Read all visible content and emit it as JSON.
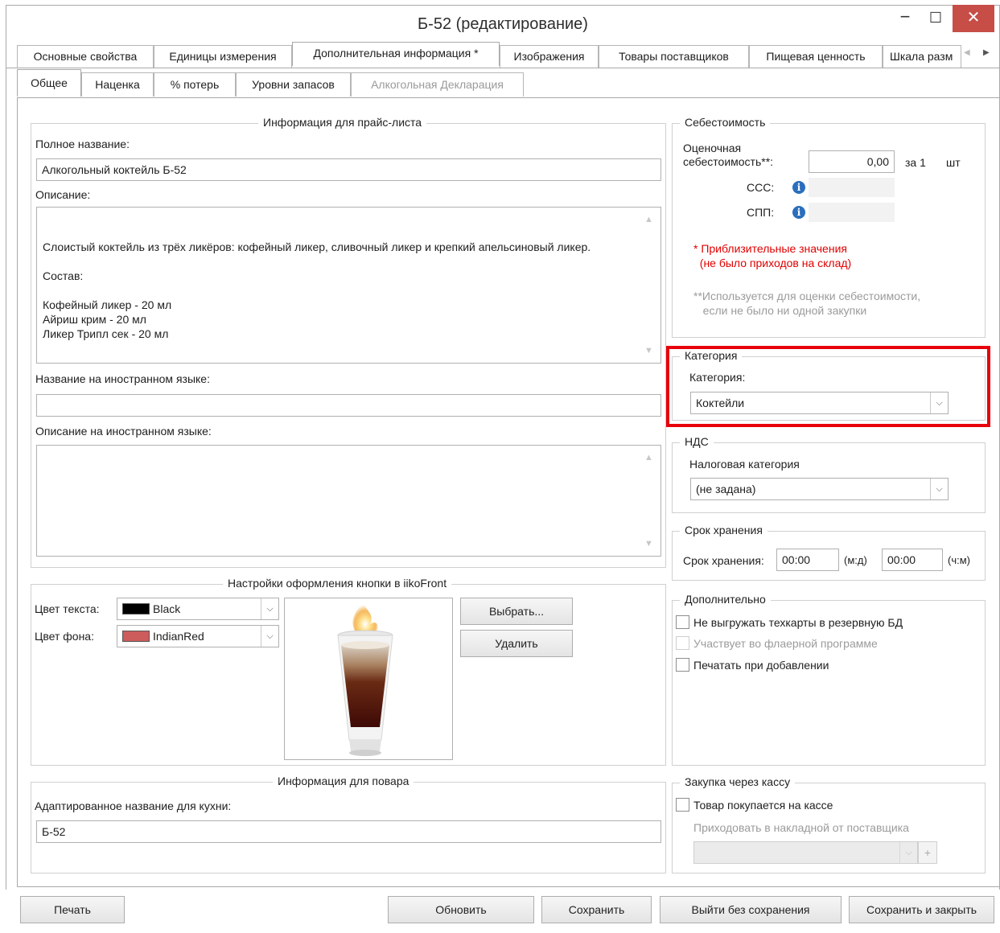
{
  "window": {
    "title": "Б-52 (редактирование)",
    "minimize": "−",
    "maximize": "☐",
    "close": "✕"
  },
  "tabs_main": [
    "Основные свойства",
    "Единицы измерения",
    "Дополнительная информация *",
    "Изображения",
    "Товары поставщиков",
    "Пищевая ценность",
    "Шкала разм"
  ],
  "tabs_sub": [
    "Общее",
    "Наценка",
    "% потерь",
    "Уровни запасов",
    "Алкогольная Декларация"
  ],
  "price_info": {
    "title": "Информация для прайс-листа",
    "full_name_label": "Полное название:",
    "full_name": "Алкогольный коктейль Б-52",
    "description_label": "Описание:",
    "description": "Слоистый коктейль из трёх ликёров: кофейный ликер, сливочный ликер и крепкий апельсиновый ликер.\n\nСостав:\n\nКофейный ликер - 20 мл\nАйриш крим - 20 мл\nЛикер Трипл сек - 20 мл",
    "foreign_name_label": "Название на иностранном языке:",
    "foreign_name": "",
    "foreign_desc_label": "Описание на иностранном языке:",
    "foreign_desc": ""
  },
  "button_settings": {
    "title": "Настройки оформления кнопки в iikoFront",
    "text_color_label": "Цвет текста:",
    "text_color_name": "Black",
    "text_color": "#000000",
    "bg_color_label": "Цвет фона:",
    "bg_color_name": "IndianRed",
    "bg_color": "#cd5c5c",
    "choose_button": "Выбрать...",
    "delete_button": "Удалить"
  },
  "cook_info": {
    "title": "Информация для повара",
    "kitchen_name_label": "Адаптированное название для кухни:",
    "kitchen_name": "Б-52"
  },
  "cost": {
    "title": "Себестоимость",
    "estimated_label_1": "Оценочная",
    "estimated_label_2": "себестоимость**:",
    "estimated_value": "0,00",
    "per_label": "за 1",
    "unit": "шт",
    "ccc_label": "ССС:",
    "cpp_label": "СПП:",
    "note_red_1": "* Приблизительные значения",
    "note_red_2": "(не было приходов на склад)",
    "note_grey_1": "**Используется для оценки себестоимости,",
    "note_grey_2": "если не было ни одной закупки"
  },
  "category": {
    "title": "Категория",
    "label": "Категория:",
    "value": "Коктейли",
    "highlight_color": "#e8000b"
  },
  "vat": {
    "title": "НДС",
    "label": "Налоговая категория",
    "value": "(не задана)"
  },
  "shelf_life": {
    "title": "Срок хранения",
    "label": "Срок хранения:",
    "value1": "00:00",
    "unit1": "(м:д)",
    "value2": "00:00",
    "unit2": "(ч:м)"
  },
  "additional": {
    "title": "Дополнительно",
    "opt1": "Не выгружать техкарты в резервную БД",
    "opt2": "Участвует во флаерной программе",
    "opt3": "Печатать при добавлении"
  },
  "purchase": {
    "title": "Закупка через кассу",
    "opt1": "Товар покупается на кассе",
    "sub_label": "Приходовать в накладной от поставщика",
    "plus": "+"
  },
  "bottom": {
    "print": "Печать",
    "refresh": "Обновить",
    "save": "Сохранить",
    "exit": "Выйти без сохранения",
    "save_close": "Сохранить и закрыть"
  }
}
